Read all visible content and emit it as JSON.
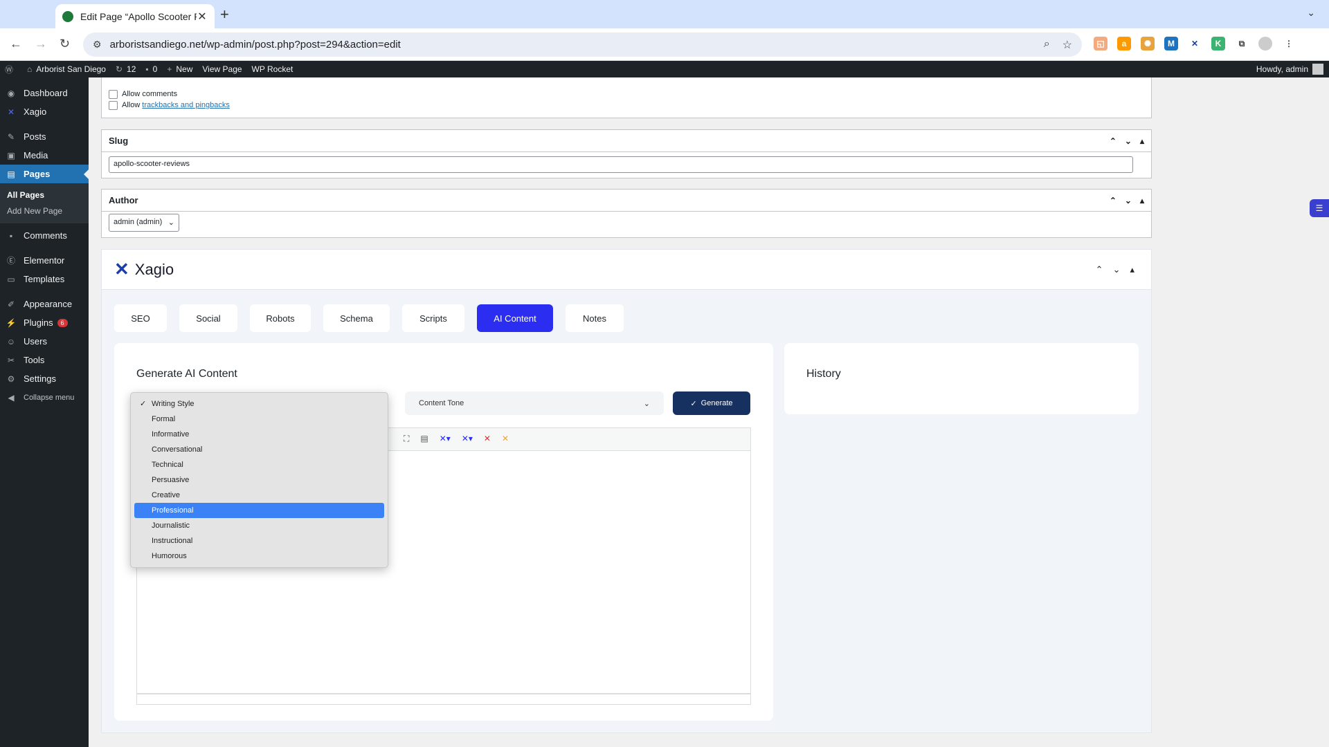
{
  "browser": {
    "tab_title": "Edit Page “Apollo Scooter Re",
    "url": "arboristsandiego.net/wp-admin/post.php?post=294&action=edit"
  },
  "adminbar": {
    "site_name": "Arborist San Diego",
    "updates": "12",
    "comments": "0",
    "new": "New",
    "view_page": "View Page",
    "wp_rocket": "WP Rocket",
    "howdy": "Howdy, admin"
  },
  "sidebar": {
    "items": [
      {
        "label": "Dashboard",
        "icon": "dashboard-icon"
      },
      {
        "label": "Xagio",
        "icon": "xagio-icon"
      },
      {
        "label": "Posts",
        "icon": "pin-icon"
      },
      {
        "label": "Media",
        "icon": "media-icon"
      },
      {
        "label": "Pages",
        "icon": "pages-icon"
      },
      {
        "label": "Comments",
        "icon": "comment-icon"
      },
      {
        "label": "Elementor",
        "icon": "elementor-icon"
      },
      {
        "label": "Templates",
        "icon": "folder-icon"
      },
      {
        "label": "Appearance",
        "icon": "brush-icon"
      },
      {
        "label": "Plugins",
        "icon": "plug-icon"
      },
      {
        "label": "Users",
        "icon": "user-icon"
      },
      {
        "label": "Tools",
        "icon": "wrench-icon"
      },
      {
        "label": "Settings",
        "icon": "settings-icon"
      },
      {
        "label": "Collapse menu",
        "icon": "collapse-icon"
      }
    ],
    "pages_sub": [
      "All Pages",
      "Add New Page"
    ],
    "plugins_badge": "6"
  },
  "discussion": {
    "allow_comments": "Allow comments",
    "allow_prefix": "Allow",
    "trackbacks_link": "trackbacks and pingbacks"
  },
  "slug": {
    "title": "Slug",
    "value": "apollo-scooter-reviews"
  },
  "author": {
    "title": "Author",
    "value": "admin (admin)"
  },
  "xagio": {
    "brand": "Xagio",
    "tabs": [
      "SEO",
      "Social",
      "Robots",
      "Schema",
      "Scripts",
      "AI Content",
      "Notes"
    ],
    "active_tab": "AI Content",
    "generate_title": "Generate AI Content",
    "content_tone": "Content Tone",
    "generate_button": "Generate",
    "history_title": "History"
  },
  "writing_style": {
    "options": [
      "Writing Style",
      "Formal",
      "Informative",
      "Conversational",
      "Technical",
      "Persuasive",
      "Creative",
      "Professional",
      "Journalistic",
      "Instructional",
      "Humorous"
    ],
    "checked": "Writing Style",
    "highlighted": "Professional"
  },
  "colors": {
    "wp_dark": "#1d2327",
    "wp_blue": "#2271b1",
    "xagio_tab_active": "#2b2ef0",
    "generate_bg": "#163060",
    "highlight": "#3b82f6"
  }
}
